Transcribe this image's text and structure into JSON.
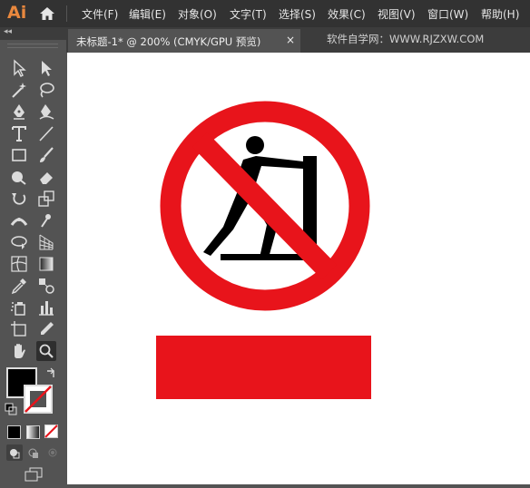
{
  "app": {
    "logo": "Ai"
  },
  "menu": [
    "文件(F)",
    "编辑(E)",
    "对象(O)",
    "文字(T)",
    "选择(S)",
    "效果(C)",
    "视图(V)",
    "窗口(W)",
    "帮助(H)"
  ],
  "panel": {
    "collapse_glyph": "◂◂"
  },
  "tab": {
    "title": "未标题-1* @ 200% (CMYK/GPU 预览)",
    "close": "×"
  },
  "watermark": "软件自学网：WWW.RJZXW.COM",
  "tools": [
    "selection-tool-icon",
    "direct-selection-tool-icon",
    "magic-wand-tool-icon",
    "lasso-tool-icon",
    "pen-tool-icon",
    "curvature-tool-icon",
    "type-tool-icon",
    "line-segment-tool-icon",
    "rectangle-tool-icon",
    "paintbrush-tool-icon",
    "shaper-tool-icon",
    "eraser-tool-icon",
    "rotate-tool-icon",
    "scale-tool-icon",
    "width-tool-icon",
    "puppet-warp-tool-icon",
    "shape-builder-tool-icon",
    "perspective-grid-tool-icon",
    "mesh-tool-icon",
    "gradient-tool-icon",
    "eyedropper-tool-icon",
    "blend-tool-icon",
    "symbol-sprayer-tool-icon",
    "column-graph-tool-icon",
    "artboard-tool-icon",
    "slice-tool-icon",
    "hand-tool-icon",
    "zoom-tool-icon"
  ],
  "colors": {
    "fill": "#000000",
    "stroke": "none",
    "sign_red": "#e8141b",
    "sign_black": "#000000",
    "accent": "#e9883e"
  }
}
